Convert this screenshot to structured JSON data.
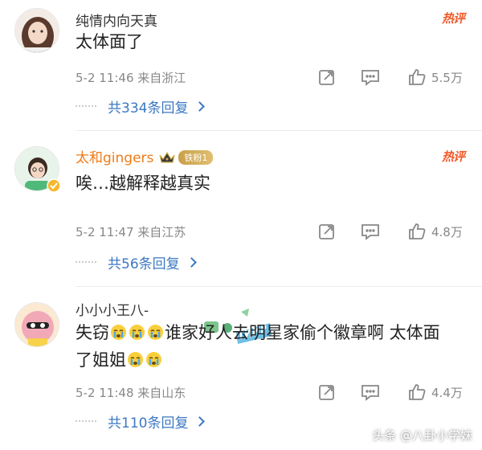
{
  "comments": [
    {
      "username": "纯情内向天真",
      "hot": "热评",
      "content": "太体面了",
      "timestamp": "5-2 11:46 来自浙江",
      "likes": "5.5万",
      "replies": "共334条回复"
    },
    {
      "username": "太和gingers",
      "fan_badge": "铁粉1",
      "hot": "热评",
      "content": "唉…越解释越真实",
      "timestamp": "5-2 11:47 来自江苏",
      "likes": "4.8万",
      "replies": "共56条回复"
    },
    {
      "username": "小小小王八-",
      "content_line1_a": "失窃",
      "content_line1_b": "谁家好人去明星家偷个徽章啊 太体面",
      "content_line2": "了姐姐",
      "timestamp": "5-2 11:48 来自山东",
      "likes": "4.4万",
      "replies": "共110条回复"
    }
  ],
  "watermark": "头条 @八卦小学妹",
  "colors": {
    "link": "#3c78c2",
    "hot": "#ef5a2a",
    "vip_name": "#f27b16",
    "meta": "#888888"
  },
  "icons": [
    "share-icon",
    "comment-icon",
    "like-icon",
    "crown-icon",
    "cry-emoji"
  ]
}
